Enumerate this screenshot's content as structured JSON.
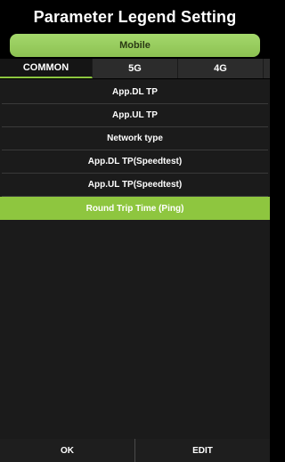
{
  "title": "Parameter Legend Setting",
  "network_button": "Mobile",
  "tabs": [
    {
      "label": "COMMON"
    },
    {
      "label": "5G"
    },
    {
      "label": "4G"
    },
    {
      "label": ""
    }
  ],
  "items": [
    {
      "label": "App.DL TP"
    },
    {
      "label": "App.UL TP"
    },
    {
      "label": "Network type"
    },
    {
      "label": "App.DL TP(Speedtest)"
    },
    {
      "label": "App.UL TP(Speedtest)"
    },
    {
      "label": "Round Trip Time (Ping)"
    }
  ],
  "selected_item": "Round Trip Time (Ping)",
  "active_tab": "COMMON",
  "buttons": {
    "ok": "OK",
    "edit": "EDIT"
  },
  "colors": {
    "accent": "#8ec63f",
    "background": "#000000",
    "list_background": "#1b1b1b"
  }
}
